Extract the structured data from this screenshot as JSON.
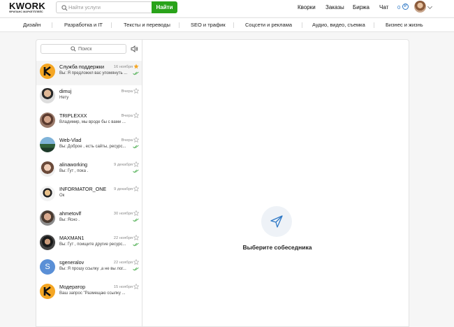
{
  "header": {
    "logo_text": "KWORK",
    "logo_subtitle": "ФРИЛАНС МАРКЕТПЛЕЙС",
    "search_placeholder": "Найти услуги",
    "search_button": "Найти",
    "nav": [
      "Кворки",
      "Заказы",
      "Биржа",
      "Чат"
    ],
    "balance": "0",
    "currency": "₽",
    "icons": {
      "search": "search-icon",
      "currency": "ruble-icon",
      "menu": "chevron-down-icon"
    }
  },
  "categories": [
    "Дизайн",
    "Разработка и IT",
    "Тексты и переводы",
    "SEO и трафик",
    "Соцсети и реклама",
    "Аудио, видео, съемка",
    "Бизнес и жизнь"
  ],
  "sidebar": {
    "search_label": "Поиск",
    "icons": {
      "search": "search-icon",
      "sound": "speaker-icon"
    }
  },
  "conversations": [
    {
      "name": "Служба поддержки",
      "date": "16 ноября",
      "preview": "Вы: Я предложил вас упомянуть ...",
      "starred": true,
      "read": true,
      "avatar": "kwork-logo"
    },
    {
      "name": "dimuj",
      "date": "Вчера",
      "preview": "Нету",
      "starred": false,
      "read": false,
      "avatar": "photo"
    },
    {
      "name": "TRIPLEXXX",
      "date": "Вчера",
      "preview": "Владимир, мы вроде бы с вами ...",
      "starred": false,
      "read": false,
      "avatar": "photo"
    },
    {
      "name": "Web-Vlad",
      "date": "Вчера",
      "preview": "Вы: Доброе , есть сайты, ресурс...",
      "starred": false,
      "read": true,
      "avatar": "photo"
    },
    {
      "name": "alinaworking",
      "date": "9 декабря",
      "preview": "Вы: Гут , пока .",
      "starred": false,
      "read": true,
      "avatar": "photo"
    },
    {
      "name": "INFORMATOR_ONE",
      "date": "9 декабря",
      "preview": "Ок",
      "starred": false,
      "read": false,
      "avatar": "photo"
    },
    {
      "name": "ahmetovlf",
      "date": "30 ноября",
      "preview": "Вы: Ясно .",
      "starred": false,
      "read": true,
      "avatar": "photo"
    },
    {
      "name": "MAXMAN1",
      "date": "22 ноября",
      "preview": "Вы: Гут , поищите другие ресурс...",
      "starred": false,
      "read": true,
      "avatar": "photo"
    },
    {
      "name": "sgeneralov",
      "date": "22 ноября",
      "preview": "Вы: Я прошу ссылку ,а не вы лог...",
      "starred": false,
      "read": true,
      "avatar": "letter",
      "letter": "S"
    },
    {
      "name": "Модератор",
      "date": "15 ноября",
      "preview": "Ваш запрос \"Размещаю ссылку ...",
      "starred": false,
      "read": false,
      "avatar": "kwork-logo"
    }
  ],
  "empty_state": {
    "text": "Выберите собеседника",
    "icon": "send-plane-icon"
  },
  "colors": {
    "accent_green": "#29a31a",
    "link_blue": "#2f79c6",
    "star_orange": "#f5a623",
    "check_green": "#3fa843"
  }
}
